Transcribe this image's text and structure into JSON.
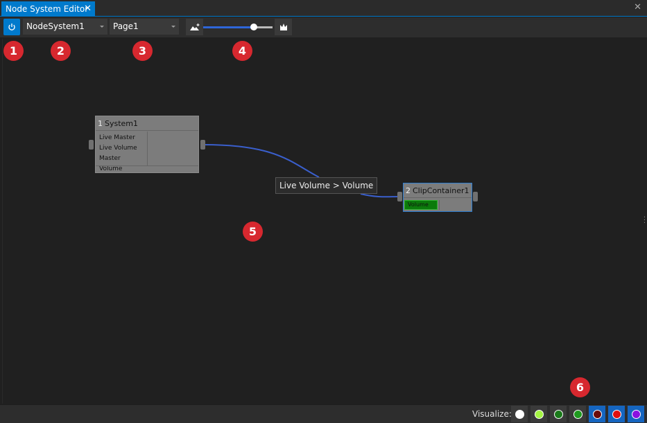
{
  "titlebar": {
    "tab_label": "Node System Editor",
    "tab_close": "✕",
    "window_close": "✕"
  },
  "toolbar": {
    "system_select": {
      "value": "NodeSystem1"
    },
    "page_select": {
      "value": "Page1"
    },
    "zoom": {
      "level": 0.73
    }
  },
  "canvas": {
    "nodes": [
      {
        "number": "1",
        "title": "System1",
        "inputs": [
          "Live Master",
          "Live Volume",
          "Master Volume"
        ]
      },
      {
        "number": "2",
        "title": "ClipContainer1",
        "inputs": [
          "Volume"
        ]
      }
    ],
    "connection_tooltip": "Live Volume > Volume"
  },
  "badges": [
    "1",
    "2",
    "3",
    "4",
    "5",
    "6"
  ],
  "statusbar": {
    "visualize_label": "Visualize:",
    "swatches": [
      {
        "color": "#ffffff",
        "active": false
      },
      {
        "color": "#a4f542",
        "active": false
      },
      {
        "color": "#1a7a1a",
        "active": false
      },
      {
        "color": "#1f9a1f",
        "active": false
      },
      {
        "color": "#6b0a0a",
        "active": true
      },
      {
        "color": "#e01010",
        "active": true
      },
      {
        "color": "#8a10e0",
        "active": true
      }
    ]
  },
  "colors": {
    "accent": "#007acc",
    "badge": "#d7282f",
    "connection": "#3a5fcd"
  }
}
